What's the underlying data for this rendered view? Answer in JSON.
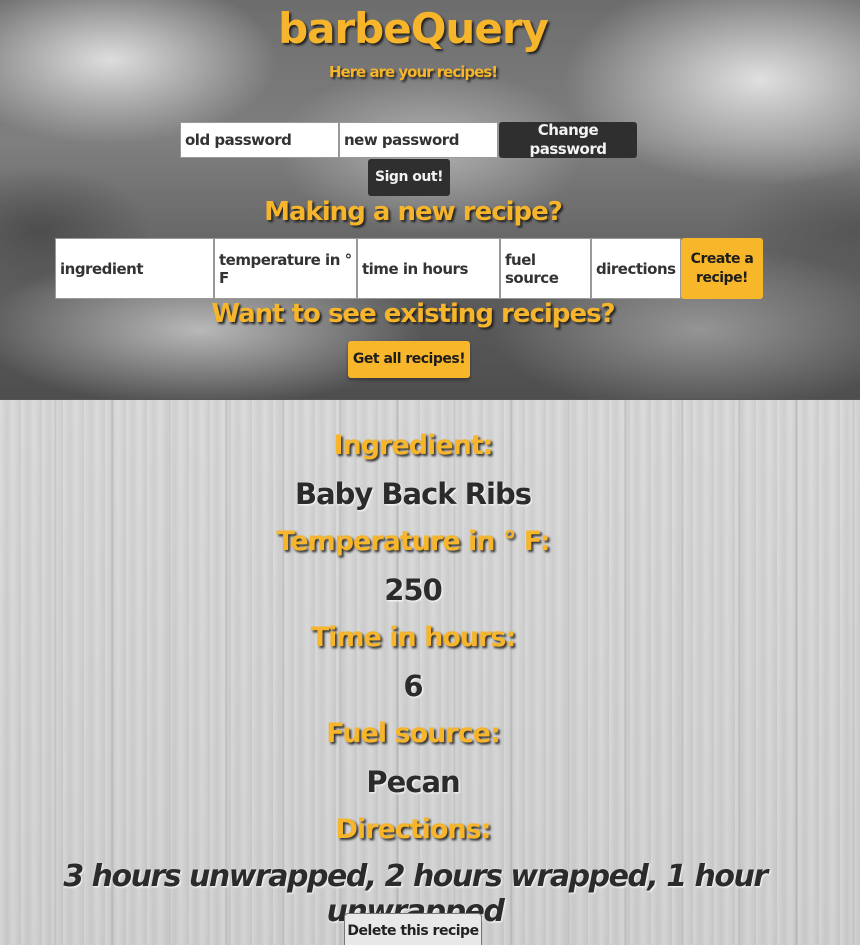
{
  "app": {
    "title": "barbeQuery",
    "subtitle": "Here are your recipes!"
  },
  "account": {
    "old_password_placeholder": "old password",
    "new_password_placeholder": "new password",
    "change_password_label": "Change password",
    "sign_out_label": "Sign out!"
  },
  "create": {
    "heading": "Making a new recipe?",
    "ingredient_placeholder": "ingredient",
    "temperature_placeholder": "temperature in ° F",
    "time_placeholder": "time in hours",
    "fuel_placeholder": "fuel source",
    "directions_placeholder": "directions",
    "create_label": "Create a recipe!"
  },
  "existing": {
    "heading": "Want to see existing recipes?",
    "get_all_label": "Get all recipes!"
  },
  "recipe": {
    "ingredient_label": "Ingredient:",
    "ingredient_value": "Baby Back Ribs",
    "temperature_label": "Temperature in ° F:",
    "temperature_value": "250",
    "time_label": "Time in hours:",
    "time_value": "6",
    "fuel_label": "Fuel source:",
    "fuel_value": "Pecan",
    "directions_label": "Directions:",
    "directions_value": "3 hours unwrapped, 2 hours wrapped, 1 hour unwrapped",
    "delete_label": "Delete this recipe"
  },
  "colors": {
    "accent": "#f8b62b",
    "dark_button": "#2f2f2f"
  }
}
